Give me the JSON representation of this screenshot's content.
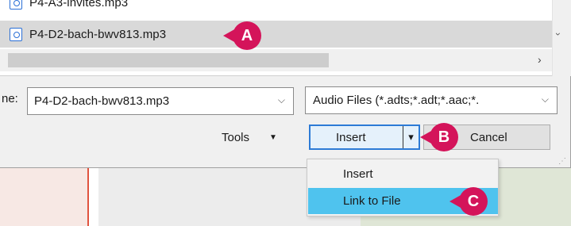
{
  "file_list": {
    "items": [
      {
        "name": "P4-A3-invites.mp3",
        "selected": false
      },
      {
        "name": "P4-D2-bach-bwv813.mp3",
        "selected": true
      }
    ]
  },
  "scroll": {
    "down_chevron": "›",
    "right_chevron": "›"
  },
  "filename": {
    "label": "ne:",
    "value": "P4-D2-bach-bwv813.mp3",
    "arrow": "⌵"
  },
  "filetype": {
    "value": "Audio Files (*.adts;*.adt;*.aac;*.",
    "arrow": "⌵"
  },
  "buttons": {
    "tools_label": "Tools",
    "tools_caret": "▼",
    "insert_label": "Insert",
    "insert_split_arrow": "▾",
    "cancel_label": "Cancel"
  },
  "insert_menu": {
    "items": [
      {
        "label": "Insert",
        "highlighted": false
      },
      {
        "label": "Link to File",
        "highlighted": true
      }
    ]
  },
  "callouts": [
    "A",
    "B",
    "C"
  ],
  "colors": {
    "callout": "#d4145a",
    "menu_highlight": "#4fc3ee",
    "focus_border": "#2d7bd6"
  }
}
